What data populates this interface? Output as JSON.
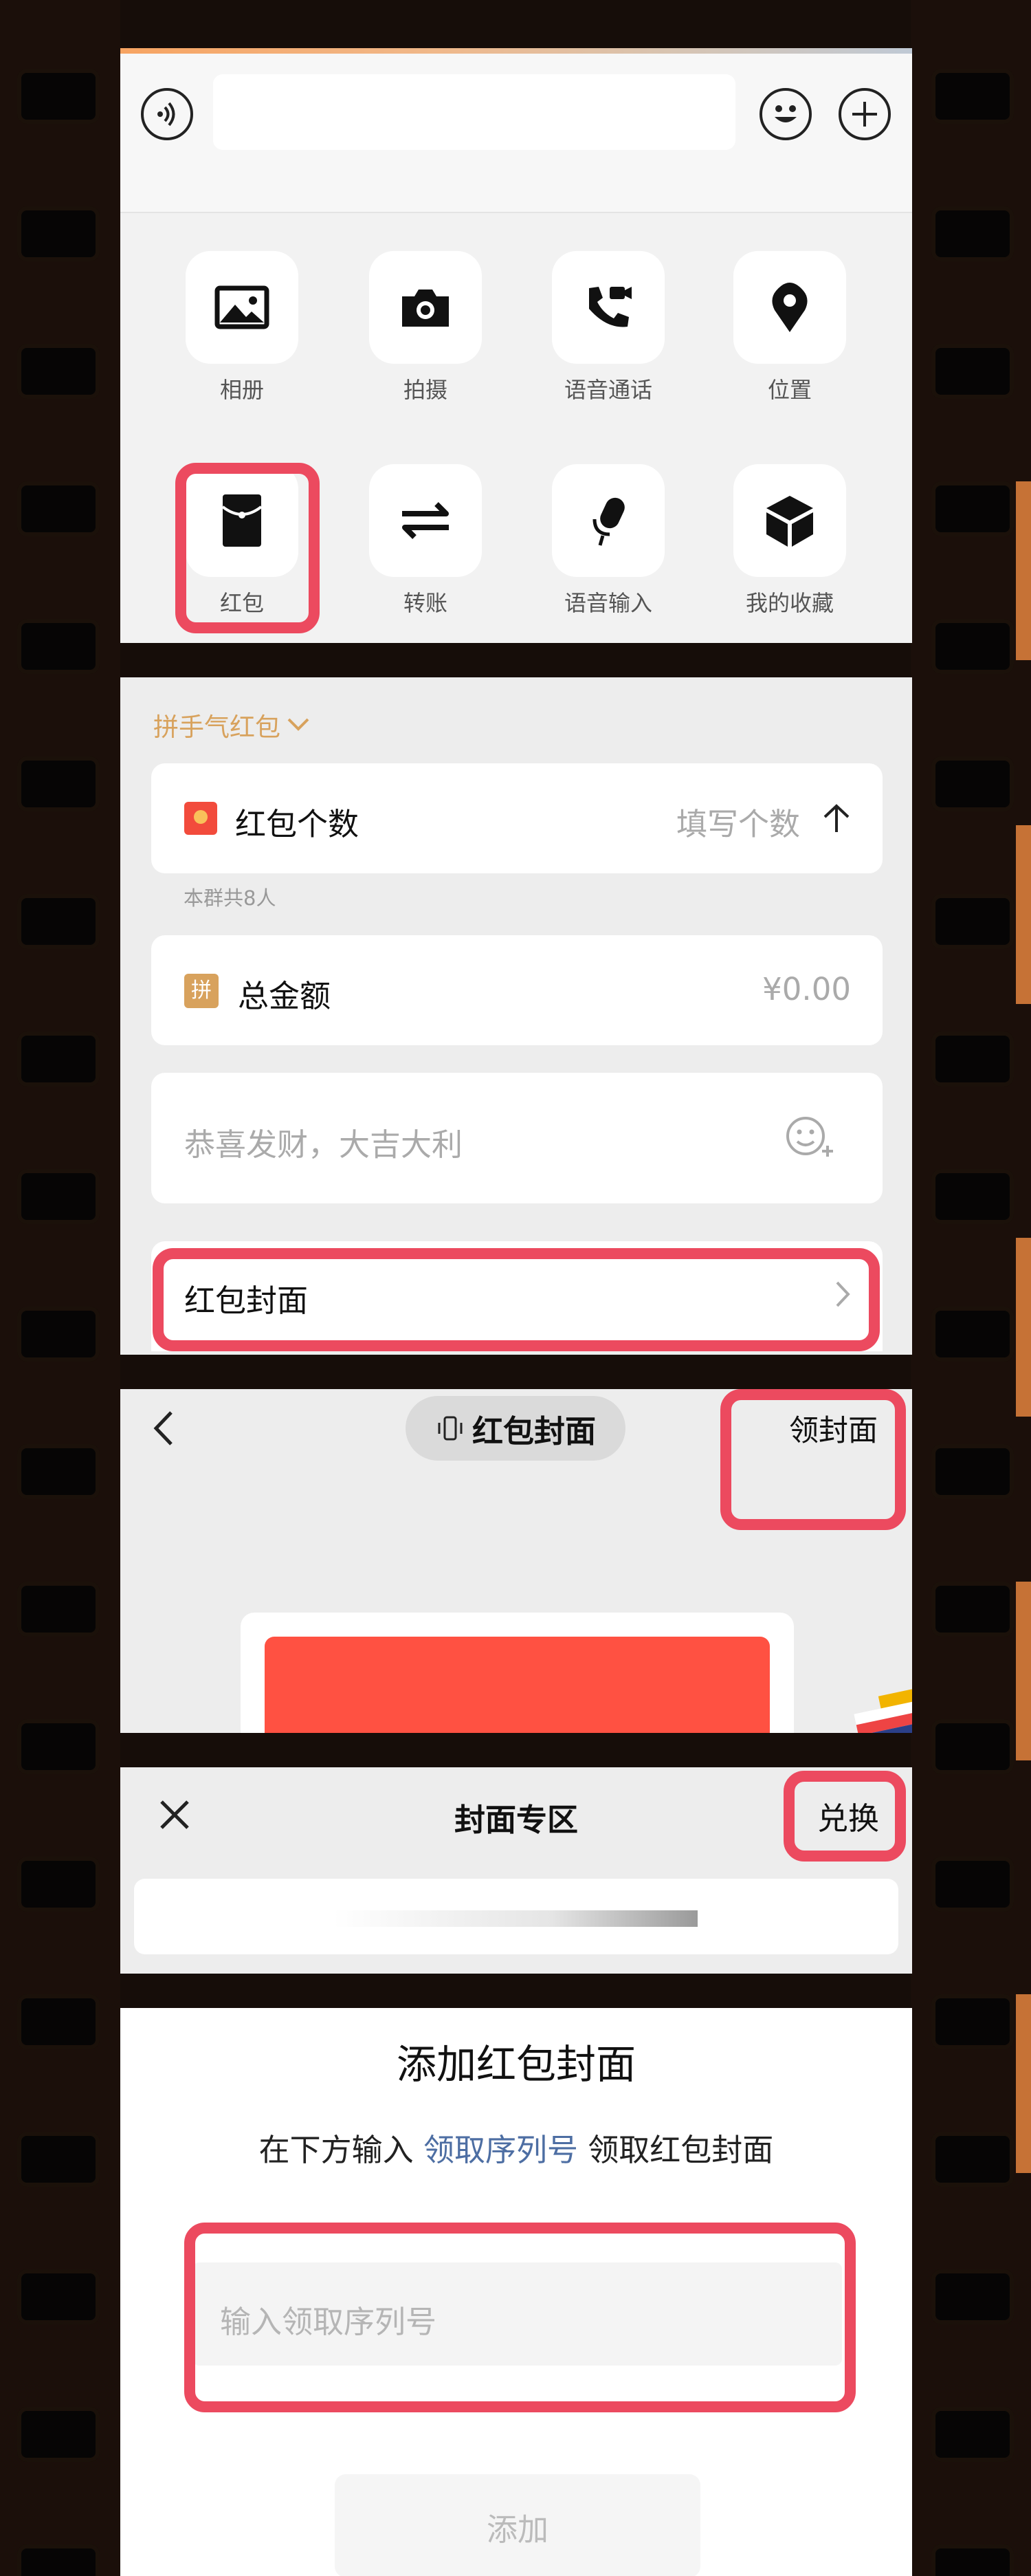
{
  "colors": {
    "accent_red": "#ec4a5f",
    "red_packet": "#ff5142",
    "link_blue": "#4d6ea3",
    "gold": "#d8a25d"
  },
  "panel1": {
    "tiles": [
      {
        "label": "相册",
        "icon": "photo-album-icon"
      },
      {
        "label": "拍摄",
        "icon": "camera-icon"
      },
      {
        "label": "语音通话",
        "icon": "video-call-icon"
      },
      {
        "label": "位置",
        "icon": "location-pin-icon"
      },
      {
        "label": "红包",
        "icon": "red-packet-icon"
      },
      {
        "label": "转账",
        "icon": "transfer-arrows-icon"
      },
      {
        "label": "语音输入",
        "icon": "microphone-icon"
      },
      {
        "label": "我的收藏",
        "icon": "favorites-cube-icon"
      }
    ]
  },
  "panel2": {
    "type_selector": "拼手气红包",
    "count_label": "红包个数",
    "count_placeholder": "填写个数",
    "group_hint": "本群共8人",
    "amount_label": "总金额",
    "amount_badge": "拼",
    "amount_value": "¥0.00",
    "greeting_placeholder": "恭喜发财，大吉大利",
    "cover_label": "红包封面"
  },
  "panel3": {
    "title": "红包封面",
    "get_cover": "领封面"
  },
  "panel4": {
    "title": "封面专区",
    "redeem": "兑换"
  },
  "panel5": {
    "title": "添加红包封面",
    "instruction_before": "在下方输入 ",
    "instruction_link": "领取序列号",
    "instruction_after": " 领取红包封面",
    "input_placeholder": "输入领取序列号",
    "add_button": "添加"
  }
}
